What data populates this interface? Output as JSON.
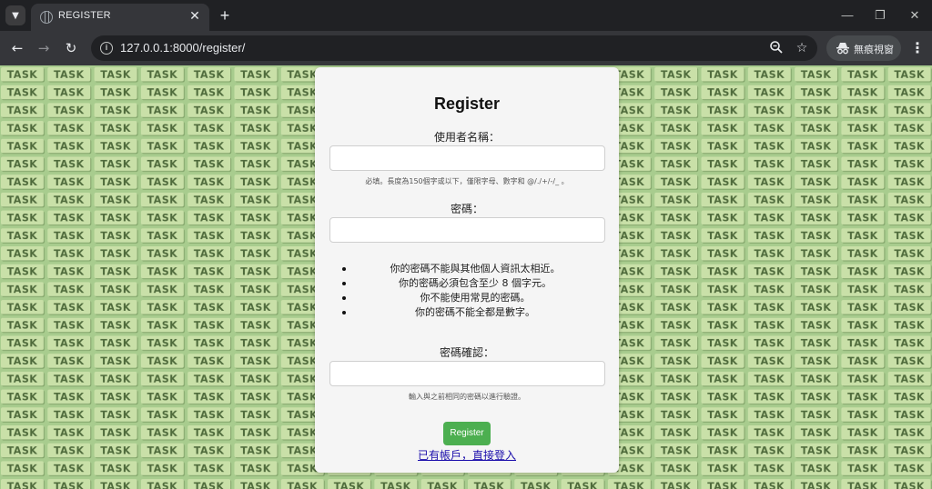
{
  "browser": {
    "tab": {
      "title": "REGISTER"
    },
    "url": "127.0.0.1:8000/register/",
    "profile_label": "無痕視窗"
  },
  "background": {
    "tile_text": "TASK"
  },
  "form": {
    "title": "Register",
    "username_label": "使用者名稱：",
    "username_value": "",
    "username_help": "必填。長度為150個字或以下，僅限字母、數字和 @/./+/-/_ 。",
    "password_label": "密碼：",
    "password_value": "",
    "password_rules": [
      "你的密碼不能與其他個人資訊太相近。",
      "你的密碼必須包含至少 8 個字元。",
      "你不能使用常見的密碼。",
      "你的密碼不能全都是數字。"
    ],
    "confirm_label": "密碼確認：",
    "confirm_value": "",
    "confirm_help": "輸入與之前相同的密碼以進行驗證。",
    "submit_label": "Register",
    "login_link": "已有帳戶，直接登入"
  },
  "colors": {
    "page_background": "#a8cc8e",
    "tile_face": "#c9e0a8",
    "tile_text": "#4f6b3c",
    "submit_button": "#4caf50",
    "link": "#1a0dab"
  }
}
